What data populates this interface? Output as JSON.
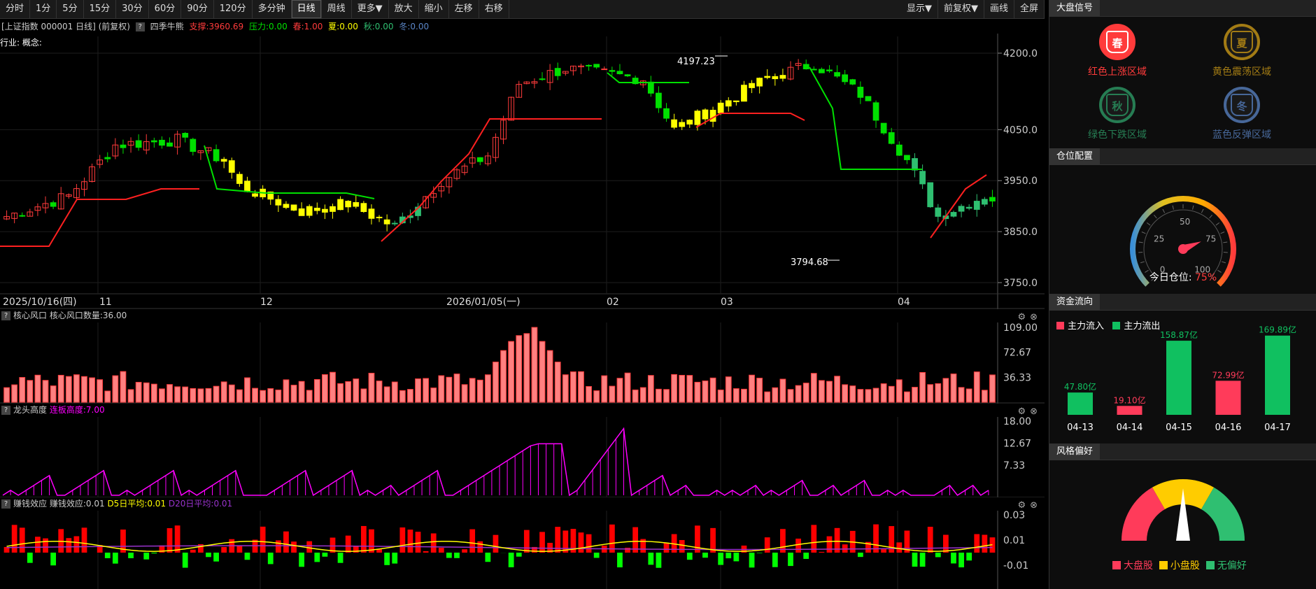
{
  "toolbar": {
    "items": [
      "分时",
      "1分",
      "5分",
      "15分",
      "30分",
      "60分",
      "90分",
      "120分",
      "多分钟",
      "日线",
      "周线",
      "更多▼",
      "放大",
      "缩小",
      "左移",
      "右移"
    ],
    "active": "日线",
    "right": [
      "显示▼",
      "前复权▼",
      "画线",
      "全屏"
    ]
  },
  "info": {
    "index": "[上证指数 000001 日线] (前复权)",
    "q": "?",
    "name": "四季牛熊",
    "support": "支撑:3960.69",
    "pressure": "压力:0.00",
    "spring": "春:1.00",
    "summer": "夏:0.00",
    "autumn": "秋:0.00",
    "winter": "冬:0.00"
  },
  "industry": "行业: 概念:",
  "main_chart": {
    "y_ticks": [
      "4200.0",
      "4050.0",
      "3950.0",
      "3850.0",
      "3750.0"
    ],
    "high_label": "4197.23",
    "low_label": "3794.68",
    "x_labels": [
      "2025/10/16(四)",
      "11",
      "12",
      "2026/01/05(一)",
      "02",
      "03",
      "04"
    ]
  },
  "panel1": {
    "title": "核心风口",
    "sub": "核心风口数量:36.00",
    "y_ticks": [
      "109.00",
      "72.67",
      "36.33"
    ]
  },
  "panel2": {
    "title": "龙头高度",
    "sub": "连板高度:7.00",
    "y_ticks": [
      "18.00",
      "12.67",
      "7.33"
    ]
  },
  "panel3": {
    "title": "赚钱效应",
    "sub": "赚钱效应:0.01",
    "d5": "D5日平均:0.01",
    "d20": "D20日平均:0.01",
    "y_ticks": [
      "0.03",
      "0.01",
      "-0.01"
    ]
  },
  "right": {
    "signal_title": "大盘信号",
    "seasons": [
      {
        "char": "春",
        "label": "红色上涨区域",
        "color": "#ff3b3b",
        "active": true
      },
      {
        "char": "夏",
        "label": "黄色震荡区域",
        "color": "#d4a017",
        "active": false
      },
      {
        "char": "秋",
        "label": "绿色下跌区域",
        "color": "#2fa36b",
        "active": false
      },
      {
        "char": "冬",
        "label": "蓝色反弹区域",
        "color": "#5b86c8",
        "active": false
      }
    ],
    "position_title": "仓位配置",
    "gauge": {
      "ticks": [
        "0",
        "25",
        "50",
        "75",
        "100"
      ],
      "label": "今日仓位:",
      "value": "75%",
      "value_num": 75
    },
    "flow_title": "资金流向",
    "flow_legend": {
      "in": "主力流入",
      "out": "主力流出"
    },
    "flow_bars": [
      {
        "date": "04-13",
        "value": 47.8,
        "label": "47.80亿",
        "dir": "out"
      },
      {
        "date": "04-14",
        "value": 19.1,
        "label": "19.10亿",
        "dir": "in"
      },
      {
        "date": "04-15",
        "value": 158.87,
        "label": "158.87亿",
        "dir": "out"
      },
      {
        "date": "04-16",
        "value": 72.99,
        "label": "72.99亿",
        "dir": "in"
      },
      {
        "date": "04-17",
        "value": 169.89,
        "label": "169.89亿",
        "dir": "out"
      }
    ],
    "style_title": "风格偏好",
    "style_legend": [
      "大盘股",
      "小盘股",
      "无偏好"
    ]
  },
  "colors": {
    "up": "#ff3b3b",
    "down": "#00e000",
    "yellow": "#ffff00",
    "teal": "#2fbf71",
    "magenta": "#ff00ff",
    "purple": "#9933cc"
  }
}
